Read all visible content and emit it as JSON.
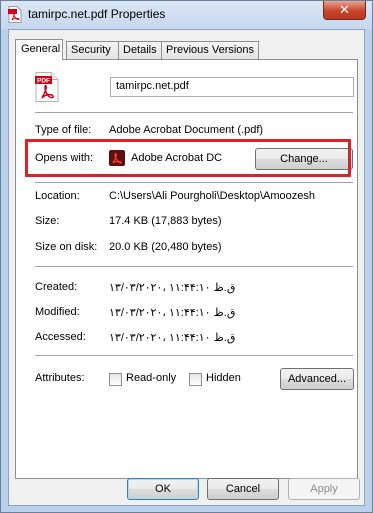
{
  "window": {
    "title": "tamirpc.net.pdf Properties",
    "close_glyph": "✕"
  },
  "tabs": [
    {
      "label": "General"
    },
    {
      "label": "Security"
    },
    {
      "label": "Details"
    },
    {
      "label": "Previous Versions"
    }
  ],
  "general": {
    "file_name": "tamirpc.net.pdf",
    "type_of_file": {
      "label": "Type of file:",
      "value": "Adobe Acrobat Document (.pdf)"
    },
    "opens_with": {
      "label": "Opens with:",
      "value": "Adobe Acrobat DC",
      "change_label": "Change..."
    },
    "location": {
      "label": "Location:",
      "value": "C:\\Users\\Ali Pourgholi\\Desktop\\Amoozesh"
    },
    "size": {
      "label": "Size:",
      "value": "17.4 KB (17,883 bytes)"
    },
    "size_on_disk": {
      "label": "Size on disk:",
      "value": "20.0 KB (20,480 bytes)"
    },
    "created": {
      "label": "Created:",
      "value": "۱۳/۰۳/۲۰۲۰، ق.ظ ۱۱:۴۴:۱۰"
    },
    "modified": {
      "label": "Modified:",
      "value": "۱۳/۰۳/۲۰۲۰، ق.ظ ۱۱:۴۴:۱۰"
    },
    "accessed": {
      "label": "Accessed:",
      "value": "۱۳/۰۳/۲۰۲۰، ق.ظ ۱۱:۴۴:۱۰"
    },
    "attributes": {
      "label": "Attributes:",
      "read_only": {
        "label": "Read-only",
        "checked": false
      },
      "hidden": {
        "label": "Hidden",
        "checked": false
      },
      "advanced_label": "Advanced..."
    }
  },
  "footer": {
    "ok_label": "OK",
    "cancel_label": "Cancel",
    "apply_label": "Apply"
  },
  "colors": {
    "highlight_border": "#d9222a",
    "pdf_red": "#d0021b",
    "acrobat_dark": "#5c1010"
  },
  "icons": {
    "title": "pdf-file-icon",
    "file": "pdf-file-icon",
    "app": "acrobat-icon"
  }
}
